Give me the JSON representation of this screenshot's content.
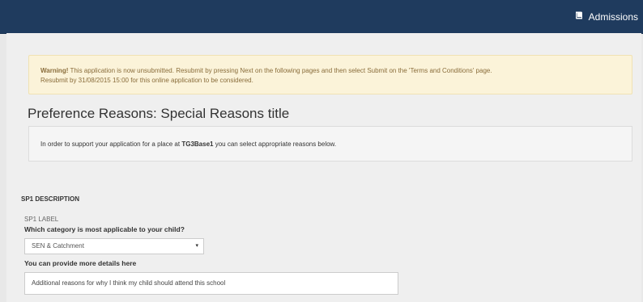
{
  "header": {
    "title": "Admissions",
    "icon": "book-icon",
    "background": "#1f3b5e"
  },
  "warning": {
    "prefix": "Warning!",
    "text_line1": " This application is now unsubmitted. Resubmit by pressing Next on the following pages and then select Submit on the 'Terms and Conditions' page.",
    "text_line2": "Resubmit by 31/08/2015 15:00 for this online application to be considered."
  },
  "page": {
    "title": "Preference Reasons: Special Reasons title"
  },
  "info": {
    "text_before": "In order to support your application for a place at ",
    "school": "TG3Base1",
    "text_after": " you can select appropriate reasons below."
  },
  "section": {
    "heading": "SP1 DESCRIPTION",
    "label": "SP1 LABEL",
    "question": "Which category is most applicable to your child?",
    "selected_category": "SEN & Catchment",
    "details_label": "You can provide more details here",
    "details_value": "Additional reasons for why I think my child should attend this school"
  }
}
